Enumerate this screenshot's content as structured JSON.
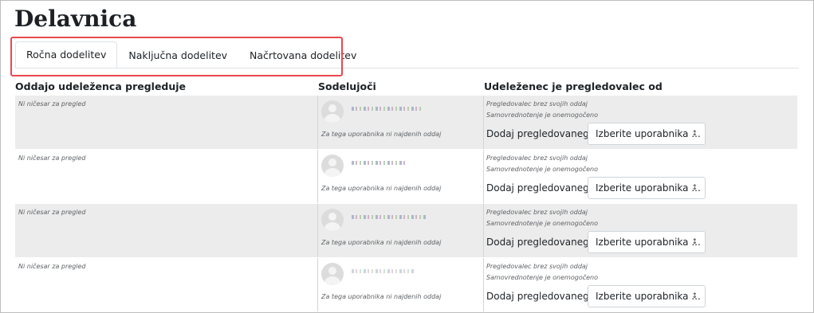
{
  "page": {
    "title": "Delavnica"
  },
  "tabs": [
    {
      "label": "Ročna dodelitev",
      "active": true
    },
    {
      "label": "Naključna dodelitev",
      "active": false
    },
    {
      "label": "Načrtovana dodelitev",
      "active": false
    }
  ],
  "table": {
    "headers": [
      "Oddajo udeleženca pregleduje",
      "Sodelujoči",
      "Udeleženec je pregledovalec od"
    ],
    "rows": [
      {
        "reviewed_by": "Ni ničesar za pregled",
        "participant_note": "Za tega uporabnika ni najdenih oddaj",
        "info_line1": "Pregledovalec brez svojih oddaj",
        "info_line2": "Samovrednotenje je onemogočeno",
        "add_label": "Dodaj pregledovanega",
        "select_value": "Izberite uporabnika ..."
      },
      {
        "reviewed_by": "Ni ničesar za pregled",
        "participant_note": "Za tega uporabnika ni najdenih oddaj",
        "info_line1": "Pregledovalec brez svojih oddaj",
        "info_line2": "Samovrednotenje je onemogočeno",
        "add_label": "Dodaj pregledovanega",
        "select_value": "Izberite uporabnika ..."
      },
      {
        "reviewed_by": "Ni ničesar za pregled",
        "participant_note": "Za tega uporabnika ni najdenih oddaj",
        "info_line1": "Pregledovalec brez svojih oddaj",
        "info_line2": "Samovrednotenje je onemogočeno",
        "add_label": "Dodaj pregledovanega",
        "select_value": "Izberite uporabnika ..."
      },
      {
        "reviewed_by": "Ni ničesar za pregled",
        "participant_note": "Za tega uporabnika ni najdenih oddaj",
        "info_line1": "Pregledovalec brez svojih oddaj",
        "info_line2": "Samovrednotenje je onemogočeno",
        "add_label": "Dodaj pregledovanega",
        "select_value": "Izberite uporabnika ..."
      }
    ]
  },
  "colors": {
    "highlight_border": "#e8484f",
    "row_shade": "#ececec"
  }
}
